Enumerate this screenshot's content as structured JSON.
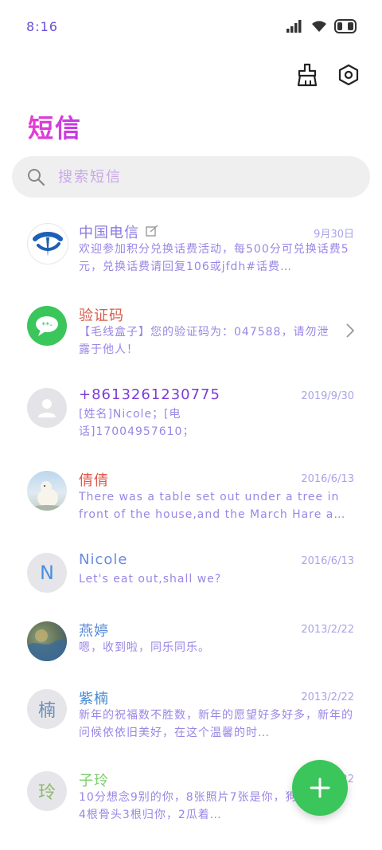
{
  "status_bar": {
    "time": "8:16",
    "icons": [
      "signal-icon",
      "wifi-icon",
      "battery-icon"
    ]
  },
  "toolbar": {
    "icons": [
      "clean-brush-icon",
      "settings-hex-icon"
    ]
  },
  "page_title": "短信",
  "search": {
    "placeholder": "搜索短信"
  },
  "conversations": [
    {
      "name": "中国电信",
      "date": "9月30日",
      "preview": "欢迎参加积分兑换话费活动，每500分可兑换话费5元，兑换话费请回复106或jfdh#话费…",
      "avatar": "telecom-logo",
      "name_color": "#8a7be0"
    },
    {
      "name": "验证码",
      "date": "",
      "preview": "【毛线盒子】您的验证码为：047588，请勿泄露于他人！",
      "avatar": "message-bubble-icon",
      "name_color": "#d85a4a"
    },
    {
      "name": "+8613261230775",
      "date": "2019/9/30",
      "preview": "[姓名]Nicole；[电话]17004957610；",
      "avatar": "person-icon",
      "name_color": "#7a3cd8"
    },
    {
      "name": "倩倩",
      "date": "2016/6/13",
      "preview": "There was a table set out under a tree in front of the house,and the March Hare a…",
      "avatar": "polar-bear-photo",
      "name_color": "#e0554a"
    },
    {
      "name": "Nicole",
      "date": "2016/6/13",
      "preview": "Let's eat out,shall we?",
      "avatar": "N",
      "name_color": "#6a8ae0"
    },
    {
      "name": "燕婷",
      "date": "2013/2/22",
      "preview": "嗯，收到啦，同乐同乐。",
      "avatar": "landscape-photo",
      "name_color": "#5a8ad8"
    },
    {
      "name": "紫楠",
      "date": "2013/2/22",
      "preview": "新年的祝福数不胜数，新年的愿望好多好多，新年的问候依依旧美好，在这个温馨的时…",
      "avatar": "楠",
      "name_color": "#4a8ad0"
    },
    {
      "name": "子玲",
      "date": "2013/2/22",
      "preview": "10分想念9别的你，8张照片7张是你，狗5只像你，4根骨头3根归你，2瓜着…",
      "avatar": "玲",
      "name_color": "#7ad06a"
    }
  ],
  "fab": {
    "icon": "plus-icon"
  },
  "colors": {
    "fab": "#3ac65a",
    "title": "#e63fd0",
    "verify_avatar": "#3ac65a",
    "telecom_blue": "#1d5fb8"
  }
}
